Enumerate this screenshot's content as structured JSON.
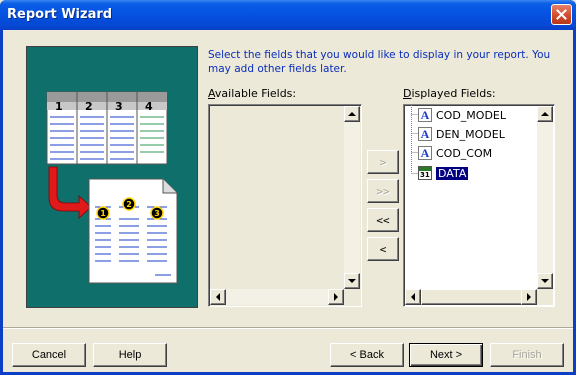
{
  "window": {
    "title": "Report Wizard"
  },
  "instruction": "Select the fields that you would like to display in your report. You may add other fields later.",
  "available": {
    "label_accel": "A",
    "label_rest": "vailable Fields:",
    "items": []
  },
  "displayed": {
    "label_accel": "D",
    "label_rest": "isplayed Fields:",
    "items": [
      {
        "label": "COD_MODEL",
        "icon": "text-field-icon"
      },
      {
        "label": "DEN_MODEL",
        "icon": "text-field-icon"
      },
      {
        "label": "COD_COM",
        "icon": "text-field-icon"
      },
      {
        "label": "DATA",
        "icon": "date-field-icon",
        "selected": true
      }
    ]
  },
  "move_buttons": {
    "add": ">",
    "add_all": ">>",
    "remove_all": "<<",
    "remove": "<"
  },
  "illustration": {
    "table_columns": [
      "1",
      "2",
      "3",
      "4"
    ],
    "report_markers": [
      "1",
      "2",
      "3"
    ]
  },
  "buttons": {
    "cancel": "Cancel",
    "help": "Help",
    "back": "< Back",
    "next": "Next >",
    "finish": "Finish"
  },
  "colors": {
    "title_bar": "#0554e3",
    "illustration_bg": "#0e6f6b",
    "instruction_text": "#0a2dbb",
    "selection": "#000080"
  }
}
